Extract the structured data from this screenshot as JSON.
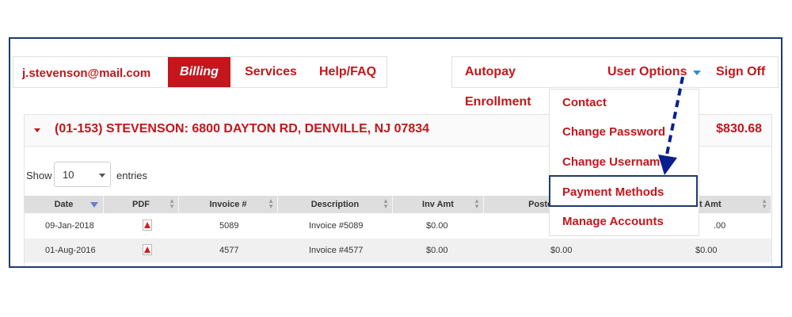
{
  "nav": {
    "email": "j.stevenson@mail.com",
    "billing": "Billing",
    "services": "Services",
    "help": "Help/FAQ",
    "autopay": "Autopay Enrollment",
    "user_options": "User Options",
    "sign_off": "Sign Off"
  },
  "account": {
    "title": "(01-153) STEVENSON: 6800 DAYTON RD, DENVILLE, NJ 07834",
    "amount": "$830.68"
  },
  "table_controls": {
    "show_label": "Show",
    "entries_value": "10",
    "entries_label": "entries"
  },
  "table": {
    "headers": [
      "Date",
      "PDF",
      "Invoice #",
      "Description",
      "Inv Amt",
      "Posted",
      "t Amt"
    ],
    "rows": [
      {
        "date": "09-Jan-2018",
        "invoice": "5089",
        "description": "Invoice #5089",
        "inv_amt": "$0.00",
        "posted": "",
        "amt": ".00"
      },
      {
        "date": "01-Aug-2016",
        "invoice": "4577",
        "description": "Invoice #4577",
        "inv_amt": "$0.00",
        "posted": "$0.00",
        "amt": "$0.00"
      }
    ]
  },
  "user_menu": {
    "items": [
      "Contact",
      "Change Password",
      "Change Usernam",
      "Payment Methods",
      "Manage Accounts"
    ],
    "highlighted": "Payment Methods"
  },
  "icons": {
    "pdf": "pdf-file-icon",
    "sort": "sort-arrows-icon",
    "dropdown": "caret-down-icon"
  },
  "colors": {
    "brand_red": "#c4161c",
    "frame_navy": "#1f3a6e",
    "caret_blue": "#2d8fd5",
    "arrow_navy": "#0a1f8f"
  }
}
